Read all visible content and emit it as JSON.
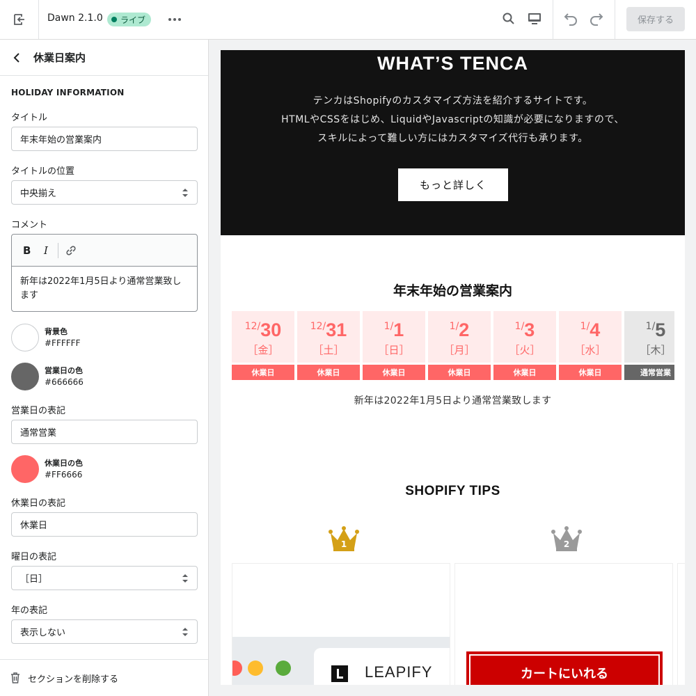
{
  "topbar": {
    "theme_title": "Dawn 2.1.0",
    "status_badge": "ライブ",
    "save_label": "保存する"
  },
  "sidebar": {
    "title": "休業日案内",
    "section_heading": "HOLIDAY INFORMATION",
    "title_label": "タイトル",
    "title_value": "年末年始の営業案内",
    "title_position_label": "タイトルの位置",
    "title_position_value": "中央揃え",
    "comment_label": "コメント",
    "comment_value": "新年は2022年1月5日より通常営業致します",
    "bg_color_label": "背景色",
    "bg_color_value": "#FFFFFF",
    "open_color_label": "営業日の色",
    "open_color_value": "#666666",
    "open_text_label": "営業日の表記",
    "open_text_value": "通常営業",
    "closed_color_label": "休業日の色",
    "closed_color_value": "#FF6666",
    "closed_text_label": "休業日の表記",
    "closed_text_value": "休業日",
    "weekday_format_label": "曜日の表記",
    "weekday_format_value": "［日］",
    "year_format_label": "年の表記",
    "year_format_value": "表示しない",
    "delete_section_label": "セクションを削除する"
  },
  "preview": {
    "hero_title": "WHAT’S TENCA",
    "hero_line1": "テンカはShopifyのカスタマイズ方法を紹介するサイトです。",
    "hero_line2": "HTMLやCSSをはじめ、LiquidやJavascriptの知識が必要になりますので、",
    "hero_line3": "スキルによって難しい方にはカスタマイズ代行も承ります。",
    "hero_button": "もっと詳しく",
    "holiday_title": "年末年始の営業案内",
    "holiday_comment": "新年は2022年1月5日より通常営業致します",
    "days": [
      {
        "month": "12",
        "day": "30",
        "weekday": "［金］",
        "status": "休業日",
        "closed": true
      },
      {
        "month": "12",
        "day": "31",
        "weekday": "［土］",
        "status": "休業日",
        "closed": true
      },
      {
        "month": "1",
        "day": "1",
        "weekday": "［日］",
        "status": "休業日",
        "closed": true
      },
      {
        "month": "1",
        "day": "2",
        "weekday": "［月］",
        "status": "休業日",
        "closed": true
      },
      {
        "month": "1",
        "day": "3",
        "weekday": "［火］",
        "status": "休業日",
        "closed": true
      },
      {
        "month": "1",
        "day": "4",
        "weekday": "［水］",
        "status": "休業日",
        "closed": true
      },
      {
        "month": "1",
        "day": "5",
        "weekday": "［木］",
        "status": "通常営業",
        "closed": false
      }
    ],
    "tips_title": "SHOPIFY TIPS",
    "rank1": "1",
    "rank2": "2",
    "card1_brand": "LEAPIFY",
    "card2_button": "カートにいれる"
  },
  "colors": {
    "closed": "#FF6666",
    "closed_bg": "#FFEBEB",
    "open": "#666666",
    "open_bg": "#E8E8E8",
    "gold": "#D4A017",
    "silver": "#9A9A9A"
  }
}
